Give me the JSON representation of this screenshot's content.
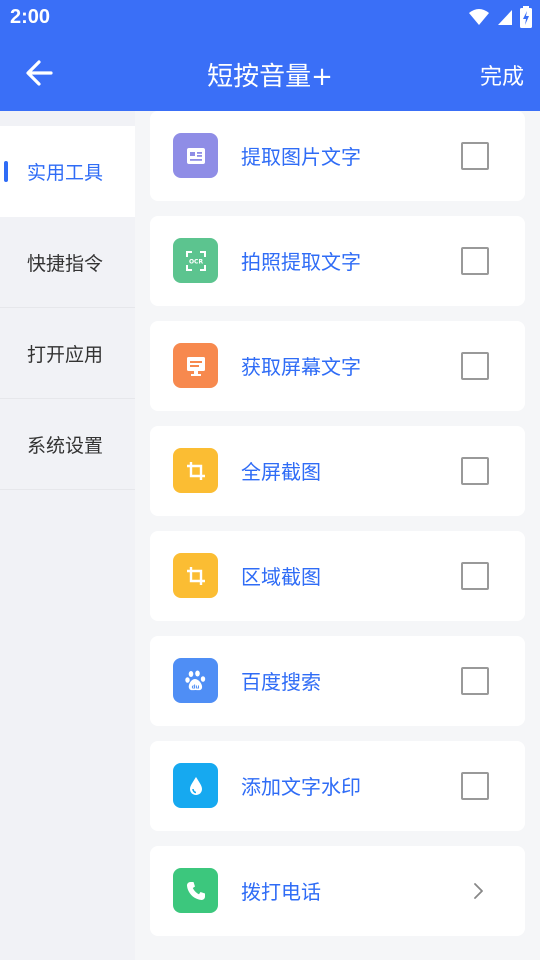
{
  "status": {
    "time": "2:00"
  },
  "header": {
    "title": "短按音量+",
    "done_label": "完成"
  },
  "sidebar": {
    "items": [
      {
        "label": "实用工具",
        "active": true
      },
      {
        "label": "快捷指令",
        "active": false
      },
      {
        "label": "打开应用",
        "active": false
      },
      {
        "label": "系统设置",
        "active": false
      }
    ]
  },
  "tools": [
    {
      "label": "提取图片文字",
      "icon": "image-text-icon",
      "color": "#8f8de6",
      "control": "checkbox",
      "checked": false
    },
    {
      "label": "拍照提取文字",
      "icon": "ocr-scan-icon",
      "color": "#5cc48f",
      "control": "checkbox",
      "checked": false
    },
    {
      "label": "获取屏幕文字",
      "icon": "screen-text-icon",
      "color": "#f7894e",
      "control": "checkbox",
      "checked": false
    },
    {
      "label": "全屏截图",
      "icon": "crop-icon",
      "color": "#fbbd33",
      "control": "checkbox",
      "checked": false
    },
    {
      "label": "区域截图",
      "icon": "crop-icon",
      "color": "#fbbd33",
      "control": "checkbox",
      "checked": false
    },
    {
      "label": "百度搜索",
      "icon": "baidu-paw-icon",
      "color": "#4f8ef5",
      "control": "checkbox",
      "checked": false
    },
    {
      "label": "添加文字水印",
      "icon": "water-drop-icon",
      "color": "#16a9f0",
      "control": "checkbox",
      "checked": false
    },
    {
      "label": "拨打电话",
      "icon": "phone-icon",
      "color": "#3cc77d",
      "control": "chevron"
    }
  ]
}
